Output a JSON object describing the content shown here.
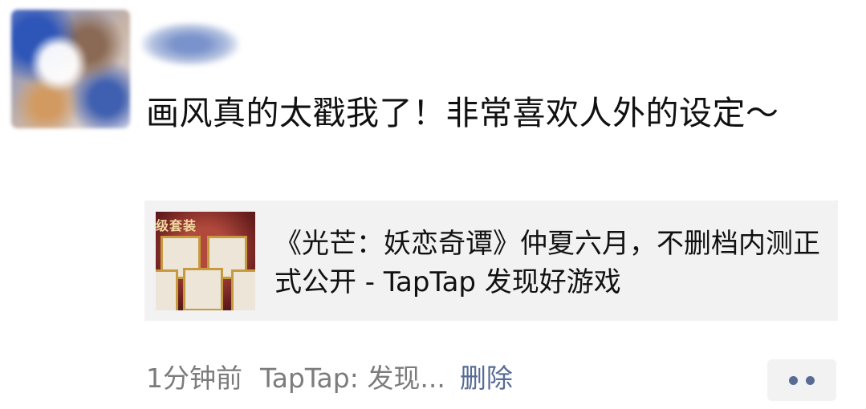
{
  "post": {
    "text": "画风真的太戳我了！非常喜欢人外的设定～"
  },
  "link_card": {
    "title": "《光芒：妖恋奇谭》仲夏六月，不删档内测正式公开 - TapTap 发现好游戏",
    "thumbnail_banner": "级套装"
  },
  "meta": {
    "time": "1分钟前",
    "source": "TapTap: 发现...",
    "delete_label": "删除"
  },
  "colors": {
    "link_blue": "#576b95",
    "card_bg": "#f2f2f2",
    "meta_gray": "#7c7c7c"
  },
  "icons": {
    "more": "more-dots-icon"
  }
}
